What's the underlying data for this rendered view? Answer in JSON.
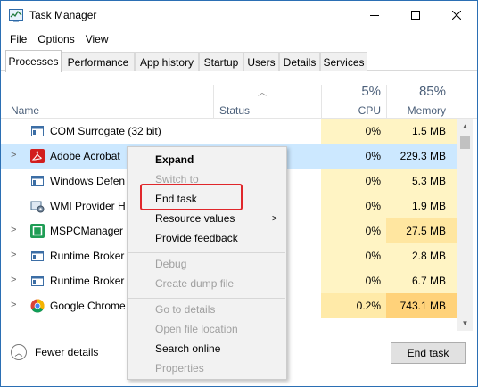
{
  "window": {
    "title": "Task Manager"
  },
  "menu": [
    "File",
    "Options",
    "View"
  ],
  "tabs": [
    "Processes",
    "Performance",
    "App history",
    "Startup",
    "Users",
    "Details",
    "Services"
  ],
  "columns": {
    "name": "Name",
    "status": "Status",
    "cpu_label": "CPU",
    "cpu_total": "5%",
    "mem_label": "Memory",
    "mem_total": "85%"
  },
  "processes": [
    {
      "name": "COM Surrogate (32 bit)",
      "cpu": "0%",
      "memory": "1.5 MB",
      "expandable": false,
      "icon": "generic-window-icon"
    },
    {
      "name": "Adobe Acrobat",
      "cpu": "0%",
      "memory": "229.3 MB",
      "expandable": true,
      "icon": "acrobat-icon"
    },
    {
      "name": "Windows Defen",
      "cpu": "0%",
      "memory": "5.3 MB",
      "expandable": false,
      "icon": "generic-window-icon"
    },
    {
      "name": "WMI Provider H",
      "cpu": "0%",
      "memory": "1.9 MB",
      "expandable": false,
      "icon": "wmi-provider-icon"
    },
    {
      "name": "MSPCManager",
      "cpu": "0%",
      "memory": "27.5 MB",
      "expandable": true,
      "icon": "pc-manager-icon"
    },
    {
      "name": "Runtime Broker",
      "cpu": "0%",
      "memory": "2.8 MB",
      "expandable": true,
      "icon": "generic-window-icon"
    },
    {
      "name": "Runtime Broker",
      "cpu": "0%",
      "memory": "6.7 MB",
      "expandable": true,
      "icon": "generic-window-icon"
    },
    {
      "name": "Google Chrome",
      "cpu": "0.2%",
      "memory": "743.1 MB",
      "expandable": true,
      "icon": "chrome-icon"
    }
  ],
  "context_menu": {
    "expand": "Expand",
    "switch_to": "Switch to",
    "end_task": "End task",
    "resource_values": "Resource values",
    "provide_feedback": "Provide feedback",
    "debug": "Debug",
    "create_dump_file": "Create dump file",
    "go_to_details": "Go to details",
    "open_file_location": "Open file location",
    "search_online": "Search online",
    "properties": "Properties"
  },
  "footer": {
    "fewer_details": "Fewer details",
    "end_task_button": "End task"
  },
  "colors": {
    "selected_row": "#cce8ff",
    "cpu_highlight": "#fff4c4",
    "memory_hot": "#ffd27a",
    "callout": "#e0272b"
  }
}
